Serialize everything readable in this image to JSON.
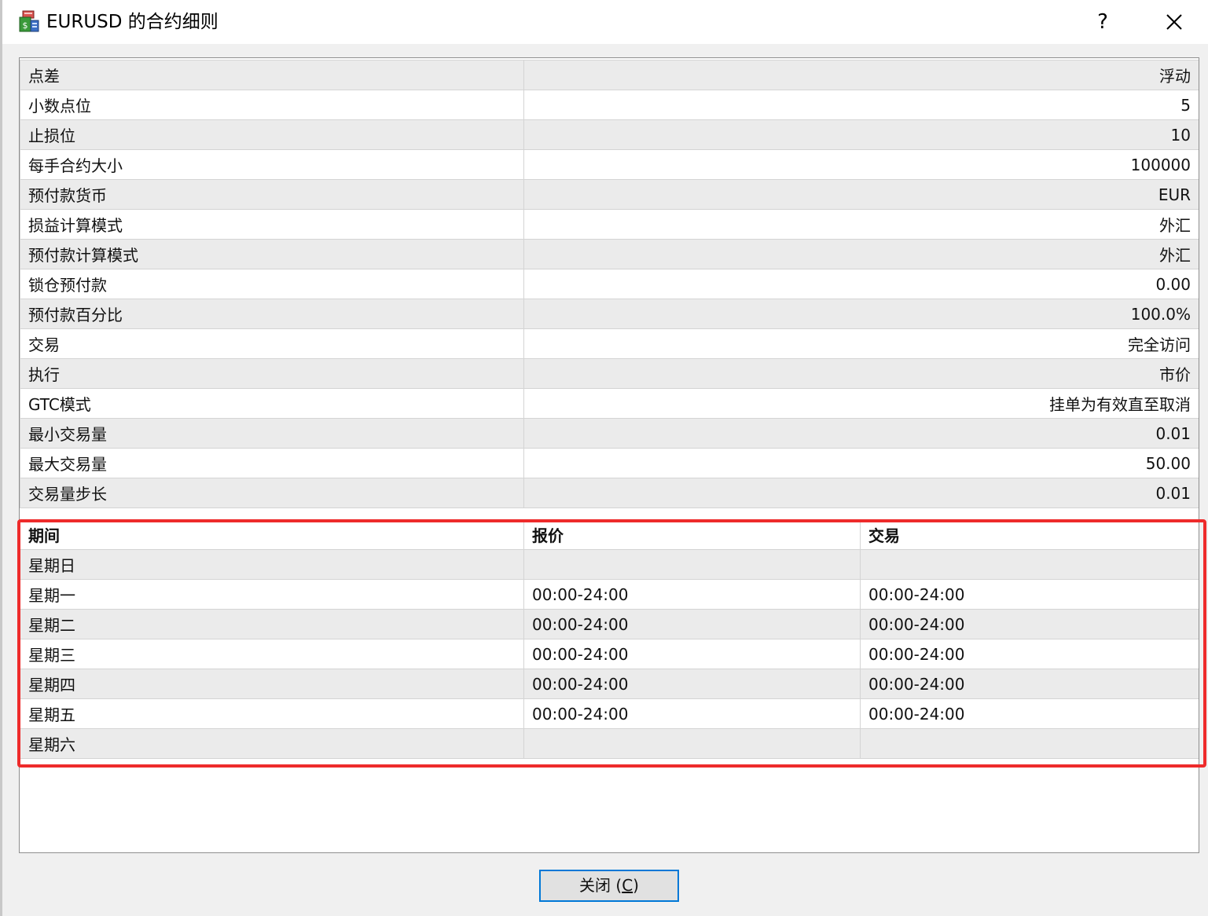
{
  "window": {
    "title": "EURUSD 的合约细则",
    "help_label": "?",
    "close_label": "✕"
  },
  "properties": [
    {
      "label": "点差",
      "value": "浮动"
    },
    {
      "label": "小数点位",
      "value": "5"
    },
    {
      "label": "止损位",
      "value": "10"
    },
    {
      "label": "每手合约大小",
      "value": "100000"
    },
    {
      "label": "预付款货币",
      "value": "EUR"
    },
    {
      "label": "损益计算模式",
      "value": "外汇"
    },
    {
      "label": "预付款计算模式",
      "value": "外汇"
    },
    {
      "label": "锁仓预付款",
      "value": "0.00"
    },
    {
      "label": "预付款百分比",
      "value": "100.0%"
    },
    {
      "label": "交易",
      "value": "完全访问"
    },
    {
      "label": "执行",
      "value": "市价"
    },
    {
      "label": "GTC模式",
      "value": "挂单为有效直至取消"
    },
    {
      "label": "最小交易量",
      "value": "0.01"
    },
    {
      "label": "最大交易量",
      "value": "50.00"
    },
    {
      "label": "交易量步长",
      "value": "0.01"
    }
  ],
  "schedule": {
    "headers": [
      "期间",
      "报价",
      "交易"
    ],
    "rows": [
      {
        "day": "星期日",
        "quotes": "",
        "trade": ""
      },
      {
        "day": "星期一",
        "quotes": "00:00-24:00",
        "trade": "00:00-24:00"
      },
      {
        "day": "星期二",
        "quotes": "00:00-24:00",
        "trade": "00:00-24:00"
      },
      {
        "day": "星期三",
        "quotes": "00:00-24:00",
        "trade": "00:00-24:00"
      },
      {
        "day": "星期四",
        "quotes": "00:00-24:00",
        "trade": "00:00-24:00"
      },
      {
        "day": "星期五",
        "quotes": "00:00-24:00",
        "trade": "00:00-24:00"
      },
      {
        "day": "星期六",
        "quotes": "",
        "trade": ""
      }
    ]
  },
  "footer": {
    "close_button_label": "关闭 (",
    "close_button_accel": "C",
    "close_button_suffix": ")"
  },
  "colors": {
    "highlight": "#ee2b2b",
    "button_border": "#0078d7"
  },
  "icons": {
    "app": "symbol-properties-icon",
    "close": "close-icon"
  }
}
